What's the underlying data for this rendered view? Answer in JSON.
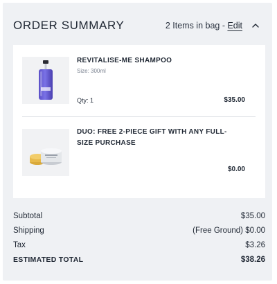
{
  "header": {
    "title": "ORDER SUMMARY",
    "items_count_text": "2 Items in bag",
    "separator": " - ",
    "edit_label": "Edit",
    "collapse_icon": "chevron-up-icon"
  },
  "items": [
    {
      "name": "REVITALISE-ME SHAMPOO",
      "size": "Size: 300ml",
      "qty": "Qty: 1",
      "price": "$35.00",
      "image": "shampoo-bottle-image"
    },
    {
      "name": "DUO: FREE 2-PIECE GIFT WITH ANY FULL-SIZE PURCHASE",
      "price": "$0.00",
      "image": "gift-jars-image"
    }
  ],
  "summary": {
    "subtotal_label": "Subtotal",
    "subtotal_value": "$35.00",
    "shipping_label": "Shipping",
    "shipping_value": "(Free Ground) $0.00",
    "tax_label": "Tax",
    "tax_value": "$3.26",
    "total_label": "ESTIMATED TOTAL",
    "total_value": "$38.26"
  }
}
